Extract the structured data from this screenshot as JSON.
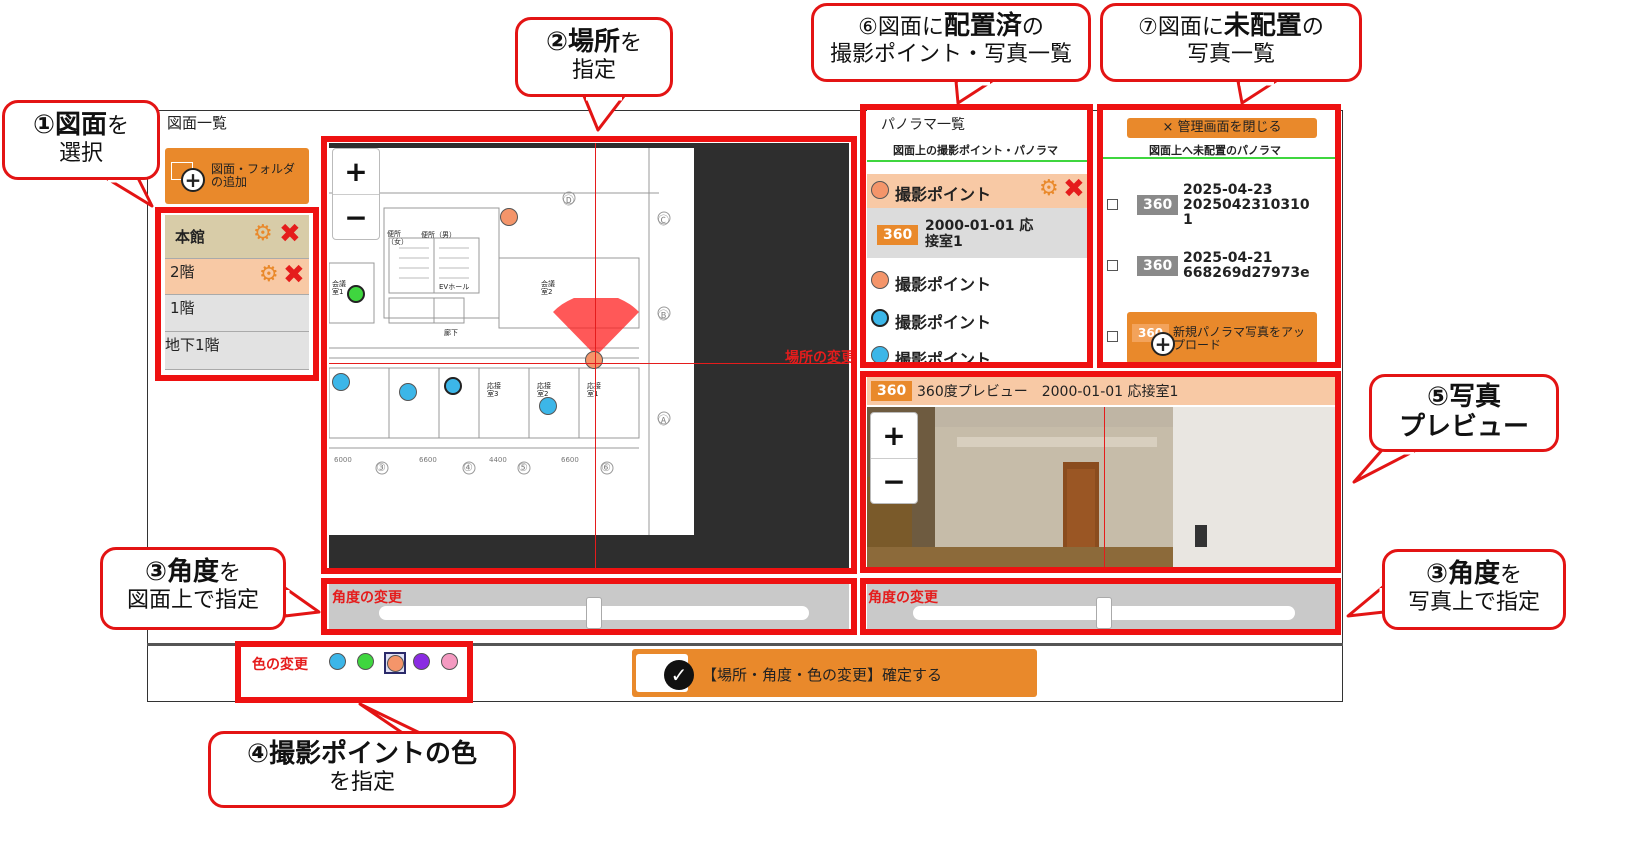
{
  "outer_title": "図面一覧",
  "add_drawing_button": "図面・フォルダの追加",
  "floors": [
    {
      "label": "本館"
    },
    {
      "label": "2階"
    },
    {
      "label": "1階"
    },
    {
      "label": "地下1階"
    }
  ],
  "map": {
    "zoom_in": "+",
    "zoom_out": "−",
    "location_change_label": "場所の変更"
  },
  "panorama_list": {
    "title": "パノラマ一覧",
    "subtitle": "図面上の撮影ポイント・パノラマ",
    "items": [
      {
        "type": "point",
        "label": "撮影ポイント",
        "color": "#f4956a"
      },
      {
        "type": "panorama",
        "badge": "360",
        "label": "2000-01-01 応接室1"
      },
      {
        "type": "point",
        "label": "撮影ポイント",
        "color": "#f4956a"
      },
      {
        "type": "point",
        "label": "撮影ポイント",
        "color": "#3cb6e8"
      },
      {
        "type": "point",
        "label": "撮影ポイント",
        "color": "#3cb6e8"
      }
    ]
  },
  "unplaced": {
    "close_button": "× 管理画面を閉じる",
    "subtitle": "図面上へ未配置のパノラマ",
    "items": [
      {
        "badge": "360",
        "line1": "2025-04-23",
        "line2": "2025042310310",
        "line3": "1"
      },
      {
        "badge": "360",
        "line1": "2025-04-21",
        "line2": "668269d27973e",
        "line3": ""
      }
    ],
    "upload_badge": "360",
    "upload_button": "新規パノラマ写真をアップロード"
  },
  "preview": {
    "badge": "360",
    "title": "360度プレビュー　2000-01-01 応接室1",
    "zoom_in": "+",
    "zoom_out": "−"
  },
  "angle_left": {
    "label": "角度の変更",
    "value": 0.5
  },
  "angle_right": {
    "label": "角度の変更",
    "value": 0.5
  },
  "color_change": {
    "label": "色の変更",
    "swatches": [
      "#3cb6e8",
      "#3fd63f",
      "#f4956a",
      "#8a2be2",
      "#f49ac1"
    ],
    "selected_index": 2
  },
  "confirm_button": "【場所・角度・色の変更】確定する",
  "floorplan_labels": {
    "toilet_f": "便所（女）",
    "toilet_m": "便所（男）",
    "ev_hall": "EVホール",
    "meeting2": "会議室2",
    "meeting1": "会議室1",
    "corridor": "廊下",
    "reception3": "応接室3",
    "reception2": "応接室2",
    "reception1": "応接室1",
    "dim1": "6000",
    "dim2": "6600",
    "dim3": "4400",
    "dim4": "6600",
    "grid3": "③",
    "grid4": "④",
    "grid5": "⑤",
    "grid6": "⑥",
    "gridC": "Ⓒ",
    "gridB": "Ⓑ",
    "gridA": "Ⓐ",
    "gridD": "Ⓓ"
  },
  "callouts": {
    "c1": {
      "big": "①図面",
      "small1": "を",
      "small2": "選択"
    },
    "c2": {
      "big": "②場所",
      "small1": "を",
      "small2": "指定"
    },
    "c3a": {
      "big": "③角度",
      "small1": "を",
      "small2": "図面上で指定"
    },
    "c3b": {
      "big": "③角度",
      "small1": "を",
      "small2": "写真上で指定"
    },
    "c4": {
      "big": "④撮影ポイントの色",
      "small2": "を指定"
    },
    "c5": {
      "big1": "⑤写真",
      "big2": "プレビュー"
    },
    "c6": {
      "num": "⑥図面に",
      "big": "配置済",
      "suffix": "の",
      "small2": "撮影ポイント・写真一覧"
    },
    "c7": {
      "num": "⑦図面に",
      "big": "未配置",
      "suffix": "の",
      "small2": "写真一覧"
    }
  }
}
